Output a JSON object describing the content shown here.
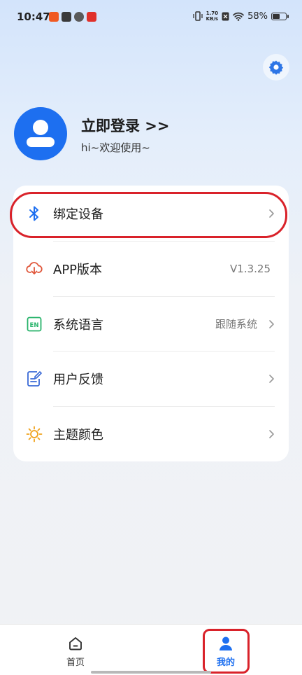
{
  "status_bar": {
    "time": "10:47",
    "net_speed_value": "1.70",
    "net_speed_unit": "KB/s",
    "battery_text": "58%",
    "battery_level_percent": 58
  },
  "profile": {
    "login_title": "立即登录 >>",
    "welcome": "hi~欢迎使用~"
  },
  "menu": {
    "items": [
      {
        "label": "绑定设备",
        "value": "",
        "icon": "bluetooth-icon",
        "has_chevron": true,
        "highlighted": true
      },
      {
        "label": "APP版本",
        "value": "V1.3.25",
        "icon": "cloud-download-icon",
        "has_chevron": false
      },
      {
        "label": "系统语言",
        "value": "跟随系统",
        "icon": "language-en-icon",
        "has_chevron": true
      },
      {
        "label": "用户反馈",
        "value": "",
        "icon": "feedback-icon",
        "has_chevron": true
      },
      {
        "label": "主题颜色",
        "value": "",
        "icon": "sun-icon",
        "has_chevron": true
      }
    ]
  },
  "bottom_nav": {
    "items": [
      {
        "label": "首页",
        "icon": "home-icon",
        "active": false
      },
      {
        "label": "我的",
        "icon": "person-icon",
        "active": true
      }
    ]
  },
  "colors": {
    "accent": "#1d6ff0",
    "highlight": "#d9222a",
    "bluetooth": "#1d6ff0",
    "cloud": "#e0563a",
    "language": "#27b36a",
    "feedback": "#3a6ad6",
    "sun": "#f0a21c"
  }
}
